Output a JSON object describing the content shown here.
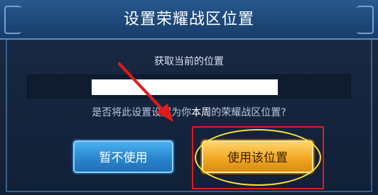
{
  "dialog": {
    "title": "设置荣耀战区位置",
    "subtitle": "获取当前的位置",
    "location_value": "",
    "question": {
      "prefix": "是否将此设置设置为你",
      "emphasis": "本周",
      "suffix": "的荣耀战区位置?"
    },
    "cancel_label": "暂不使用",
    "confirm_label": "使用该位置"
  },
  "colors": {
    "annotation_red": "#e01b1b",
    "annotation_yellow": "#ffe03a"
  }
}
